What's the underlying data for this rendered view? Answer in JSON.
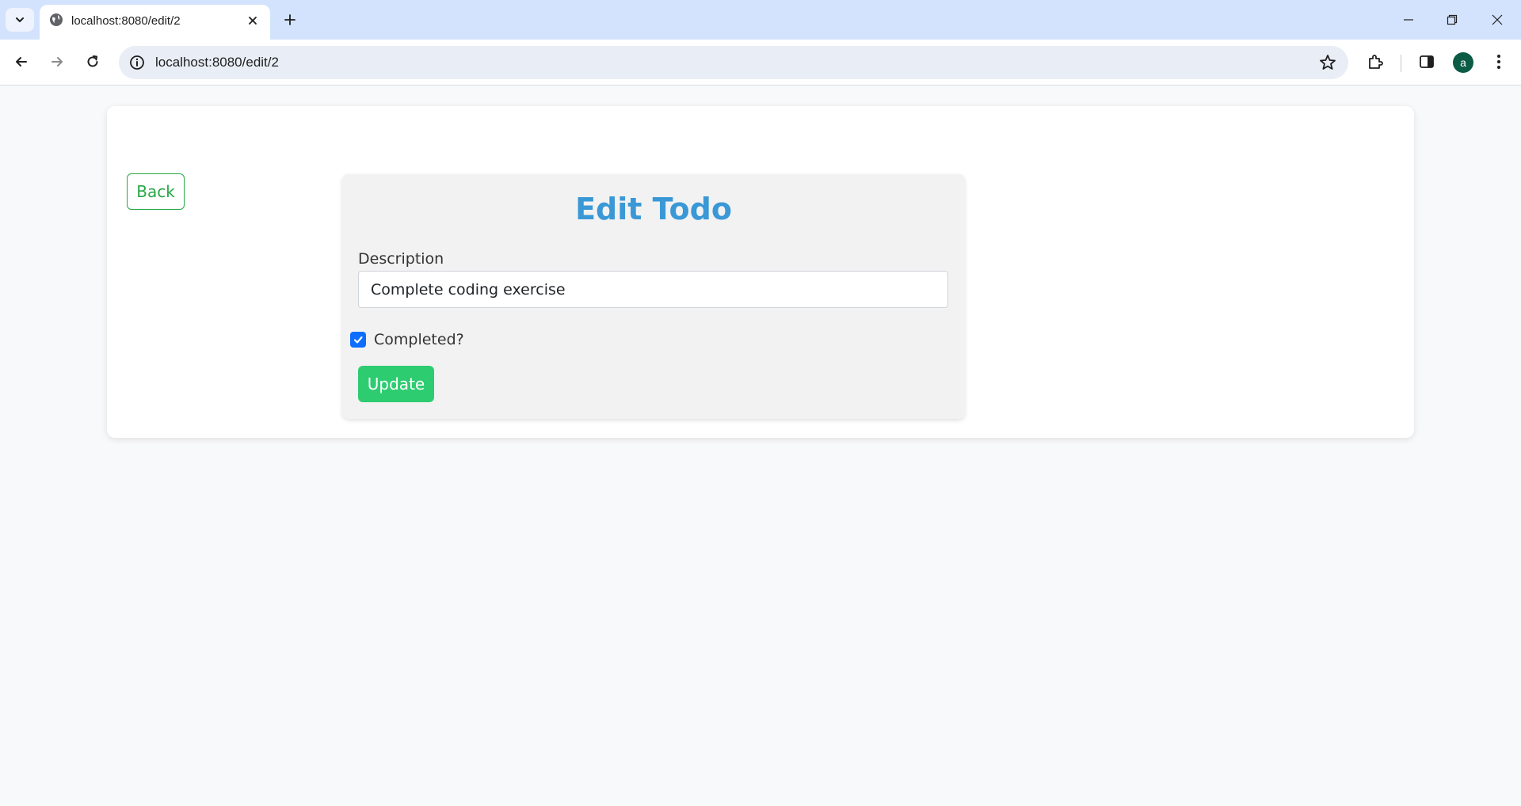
{
  "browser": {
    "tab_title": "localhost:8080/edit/2",
    "url": "localhost:8080/edit/2",
    "profile_initial": "a"
  },
  "page": {
    "back_label": "Back",
    "form": {
      "title": "Edit Todo",
      "description_label": "Description",
      "description_value": "Complete coding exercise",
      "completed_label": "Completed?",
      "completed_checked": true,
      "update_label": "Update"
    }
  },
  "colors": {
    "tabstrip": "#d3e3fd",
    "title": "#3a98d6",
    "back_border": "#28a745",
    "update_bg": "#2ecc71",
    "checkbox": "#0d6efd",
    "avatar": "#0b5b45"
  }
}
